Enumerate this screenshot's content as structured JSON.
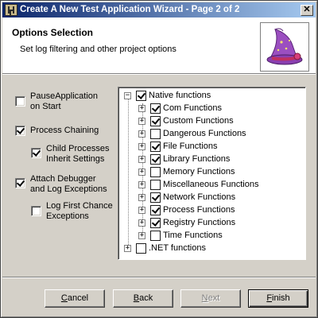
{
  "window": {
    "title": "Create A New Test Application Wizard - Page 2 of 2",
    "close_glyph": "✕"
  },
  "header": {
    "title": "Options Selection",
    "subtitle": "Set log filtering and other project options",
    "image_icon": "wizard-hat-icon"
  },
  "options": [
    {
      "label_line1": "PauseApplication",
      "label_line2": "on Start",
      "checked": false
    },
    {
      "label_line1": "Process Chaining",
      "label_line2": "",
      "checked": true
    },
    {
      "label_line1": "Child Processes",
      "label_line2": "Inherit Settings",
      "checked": true
    },
    {
      "label_line1": "Attach Debugger",
      "label_line2": "and Log Exceptions",
      "checked": true
    },
    {
      "label_line1": "Log First Chance",
      "label_line2": "Exceptions",
      "checked": false
    }
  ],
  "tree": {
    "root": {
      "label": "Native functions",
      "checked": true,
      "expander": "−"
    },
    "children": [
      {
        "label": "Com Functions",
        "checked": true,
        "expander": "+"
      },
      {
        "label": "Custom Functions",
        "checked": true,
        "expander": "+"
      },
      {
        "label": "Dangerous Functions",
        "checked": false,
        "expander": "+"
      },
      {
        "label": "File Functions",
        "checked": true,
        "expander": "+"
      },
      {
        "label": "Library Functions",
        "checked": true,
        "expander": "+"
      },
      {
        "label": "Memory Functions",
        "checked": false,
        "expander": "+"
      },
      {
        "label": "Miscellaneous Functions",
        "checked": false,
        "expander": "+"
      },
      {
        "label": "Network Functions",
        "checked": true,
        "expander": "+"
      },
      {
        "label": "Process Functions",
        "checked": true,
        "expander": "+"
      },
      {
        "label": "Registry Functions",
        "checked": true,
        "expander": "+"
      },
      {
        "label": "Time Functions",
        "checked": false,
        "expander": "+"
      }
    ],
    "second_root": {
      "label": ".NET functions",
      "checked": false,
      "expander": "+"
    }
  },
  "buttons": {
    "cancel": {
      "mnemonic": "C",
      "rest": "ancel",
      "enabled": true
    },
    "back": {
      "mnemonic": "B",
      "rest": "ack",
      "enabled": true
    },
    "next": {
      "mnemonic": "N",
      "rest": "ext",
      "enabled": false
    },
    "finish": {
      "mnemonic": "F",
      "rest": "inish",
      "enabled": true
    }
  },
  "colors": {
    "titlebar_start": "#0a246a",
    "titlebar_end": "#a6caf0",
    "face": "#d4d0c8",
    "hat_purple": "#9b4fc0",
    "hat_band": "#c03060"
  }
}
